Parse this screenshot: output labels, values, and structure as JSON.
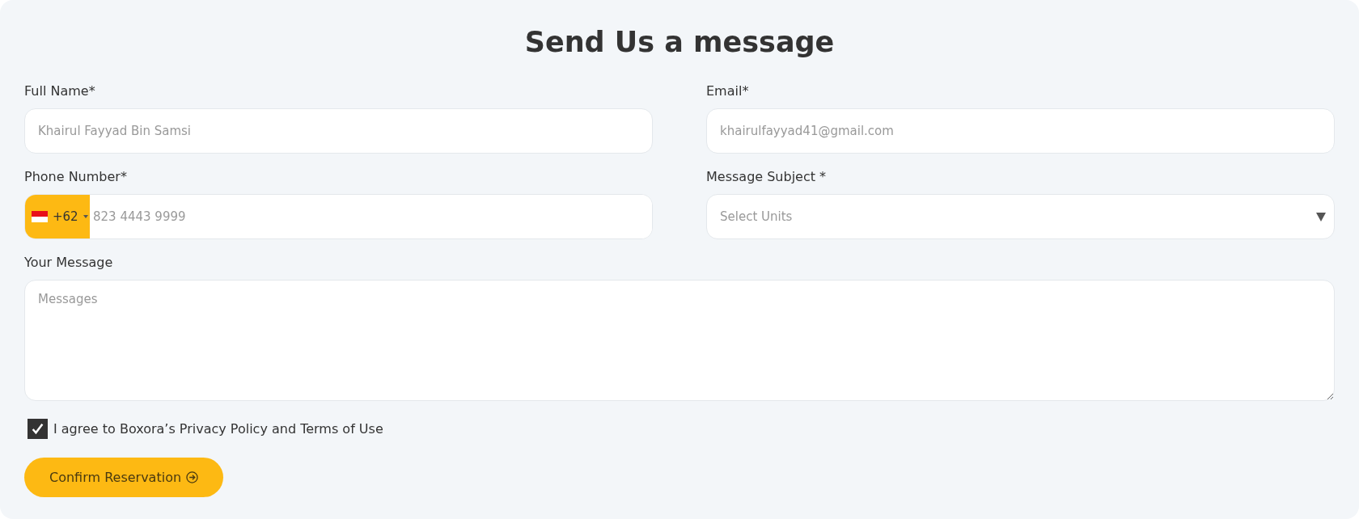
{
  "title": "Send Us a message",
  "fields": [
    {
      "kind": "text",
      "label": "Full Name*",
      "placeholder": "Khairul Fayyad Bin Samsi"
    },
    {
      "kind": "text",
      "label": "Email*",
      "placeholder": "khairulfayyad41@gmail.com"
    },
    {
      "kind": "phone",
      "label": "Phone Number*",
      "code": "+62",
      "placeholder": "823 4443 9999"
    },
    {
      "kind": "select",
      "label": "Message Subject *",
      "placeholder": "Select Units"
    },
    {
      "kind": "textarea",
      "label": "Your Message",
      "placeholder": "Messages"
    }
  ],
  "agreement": {
    "label": "I agree to Boxora’s Privacy Policy and Terms of Use",
    "checked": true
  },
  "submit": {
    "label": "Confirm Reservation"
  }
}
